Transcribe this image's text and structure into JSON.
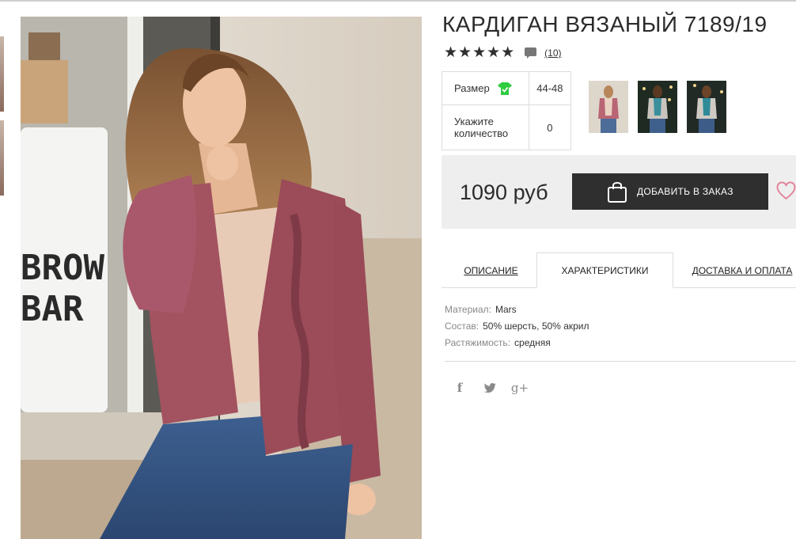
{
  "product": {
    "title": "КАРДИГАН ВЯЗАНЫЙ 7189/19",
    "stars": "★★★★★",
    "rating_value": 5,
    "rating_max": 5,
    "reviews_count": "(10)"
  },
  "options": {
    "size_label": "Размер",
    "size_value": "44-48",
    "qty_label": "Укажите количество",
    "qty_value": "0"
  },
  "purchase": {
    "price": "1090 руб",
    "order_button": "ДОБАВИТЬ В ЗАКАЗ"
  },
  "tabs": [
    {
      "label": "ОПИСАНИЕ",
      "active": false
    },
    {
      "label": "ХАРАКТЕРИСТИКИ",
      "active": true
    },
    {
      "label": "ДОСТАВКА И ОПЛАТА",
      "active": false
    }
  ],
  "characteristics": [
    {
      "key": "Материал:",
      "value": "Mars"
    },
    {
      "key": "Состав:",
      "value": "50% шерсть, 50% акрил"
    },
    {
      "key": "Растяжимость:",
      "value": "средняя"
    }
  ],
  "social": {
    "facebook": "f",
    "twitter": "🐦",
    "google": "g+"
  },
  "photo_text": {
    "sign_line1": "BROW",
    "sign_line2": "BAR"
  },
  "icons": [
    "comment-icon",
    "tshirt-size-icon",
    "shopping-bag-icon",
    "heart-icon",
    "facebook-icon",
    "twitter-icon",
    "google-plus-icon"
  ],
  "colors": {
    "cardigan": "#a3525f",
    "button_bg": "#2f2f2f",
    "size_icon": "#2ecc40",
    "buy_box_bg": "#eeeeee"
  }
}
